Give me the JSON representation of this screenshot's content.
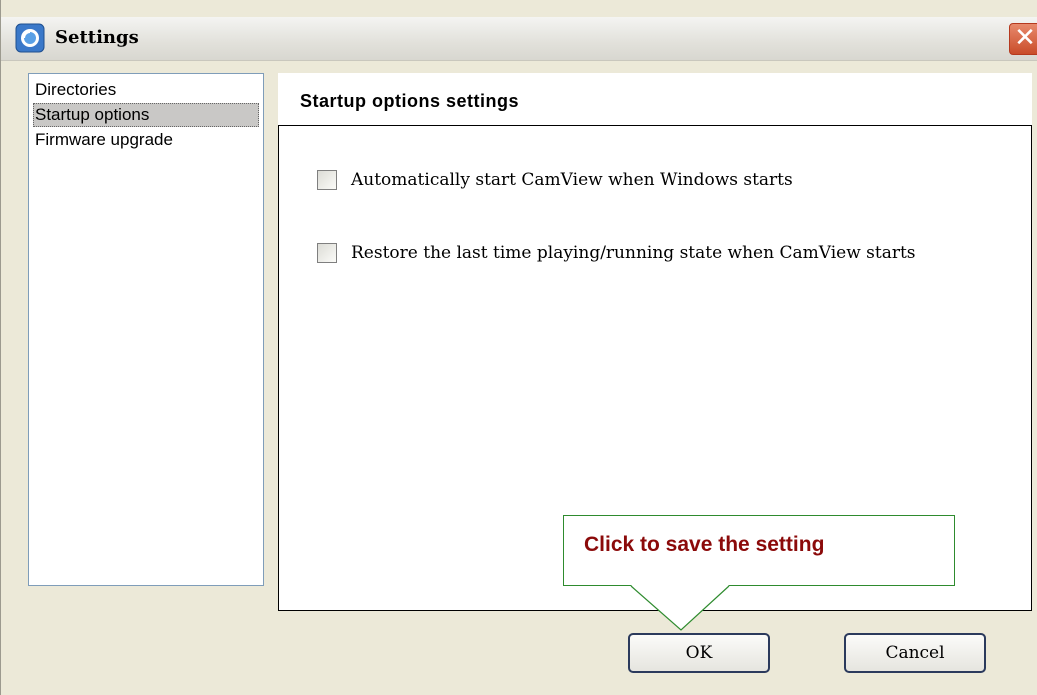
{
  "window": {
    "title": "Settings",
    "close_label": "✕"
  },
  "sidebar": {
    "items": [
      {
        "label": "Directories",
        "selected": false
      },
      {
        "label": "Startup options",
        "selected": true
      },
      {
        "label": "Firmware upgrade",
        "selected": false
      }
    ]
  },
  "panel": {
    "title": "Startup options settings",
    "options": [
      {
        "label": "Automatically start CamView when Windows starts",
        "checked": false
      },
      {
        "label": "Restore the last time playing/running state when CamView starts",
        "checked": false
      }
    ]
  },
  "callout": {
    "text": "Click to save the setting"
  },
  "buttons": {
    "ok_label": "OK",
    "cancel_label": "Cancel"
  },
  "colors": {
    "callout_border": "#2e8b2e",
    "callout_text": "#8B0A0A",
    "close_button": "#c94c2a"
  },
  "icons": {
    "app": "camview-app-icon",
    "close": "close-icon"
  }
}
